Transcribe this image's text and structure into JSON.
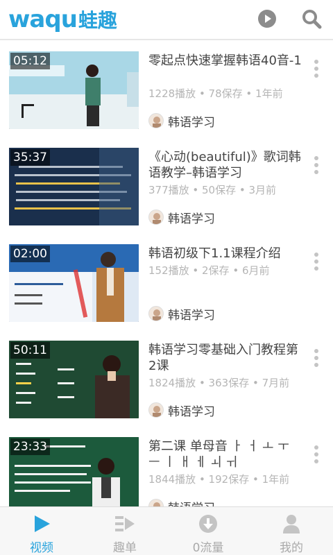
{
  "app": {
    "logo_latin": "waqu",
    "logo_cn": "蛙趣",
    "brand_color": "#29a3dc",
    "header_icons": [
      "play-icon",
      "search-icon"
    ]
  },
  "videos": [
    {
      "duration": "05:12",
      "title": "零起点快速掌握韩语40音-1",
      "meta": "1228播放 • 78保存 • 1年前",
      "channel": "韩语学习"
    },
    {
      "duration": "35:37",
      "title": "《心动(beautiful)》歌词韩语教学–韩语学习",
      "meta": "377播放 • 50保存 • 3月前",
      "channel": "韩语学习"
    },
    {
      "duration": "02:00",
      "title": "韩语初级下1.1课程介绍",
      "meta": "152播放 • 2保存 • 6月前",
      "channel": "韩语学习"
    },
    {
      "duration": "50:11",
      "title": "韩语学习零基础入门教程第2课",
      "meta": "1824播放 • 363保存 • 7月前",
      "channel": "韩语学习"
    },
    {
      "duration": "23:33",
      "title": "第二课 单母音 ㅏ ㅓ ㅗ ㅜ ㅡ ㅣ ㅐ ㅔ ㅚ ㅟ",
      "meta": "1844播放 • 192保存 • 1年前",
      "channel": "韩语学习"
    }
  ],
  "bottom_nav": [
    {
      "label": "视频",
      "icon": "video-play-icon",
      "active": true
    },
    {
      "label": "趣单",
      "icon": "playlist-icon",
      "active": false
    },
    {
      "label": "0流量",
      "icon": "download-icon",
      "active": false
    },
    {
      "label": "我的",
      "icon": "user-icon",
      "active": false
    }
  ]
}
